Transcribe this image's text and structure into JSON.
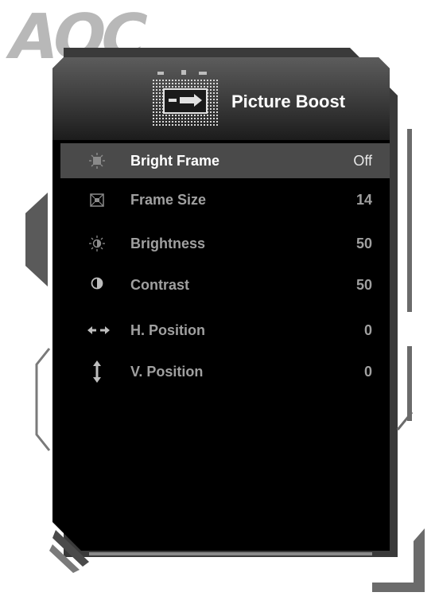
{
  "brand": {
    "logo_text": "AOC"
  },
  "header": {
    "title": "Picture Boost",
    "icon": "picture-boost-icon"
  },
  "menu": {
    "items": [
      {
        "label": "Bright Frame",
        "value": "Off",
        "icon": "bright-frame-icon",
        "selected": true
      },
      {
        "label": "Frame Size",
        "value": "14",
        "icon": "frame-size-icon",
        "selected": false
      },
      {
        "label": "Brightness",
        "value": "50",
        "icon": "brightness-icon",
        "selected": false
      },
      {
        "label": "Contrast",
        "value": "50",
        "icon": "contrast-icon",
        "selected": false
      },
      {
        "label": "H. Position",
        "value": "0",
        "icon": "h-position-icon",
        "selected": false
      },
      {
        "label": "V. Position",
        "value": "0",
        "icon": "v-position-icon",
        "selected": false
      }
    ]
  },
  "colors": {
    "panel_bg": "#000000",
    "selected_row_bg": "#4a4a4a",
    "label_inactive": "#a0a0a0",
    "label_active": "#ffffff",
    "frame_gray": "#6b6b6b"
  }
}
